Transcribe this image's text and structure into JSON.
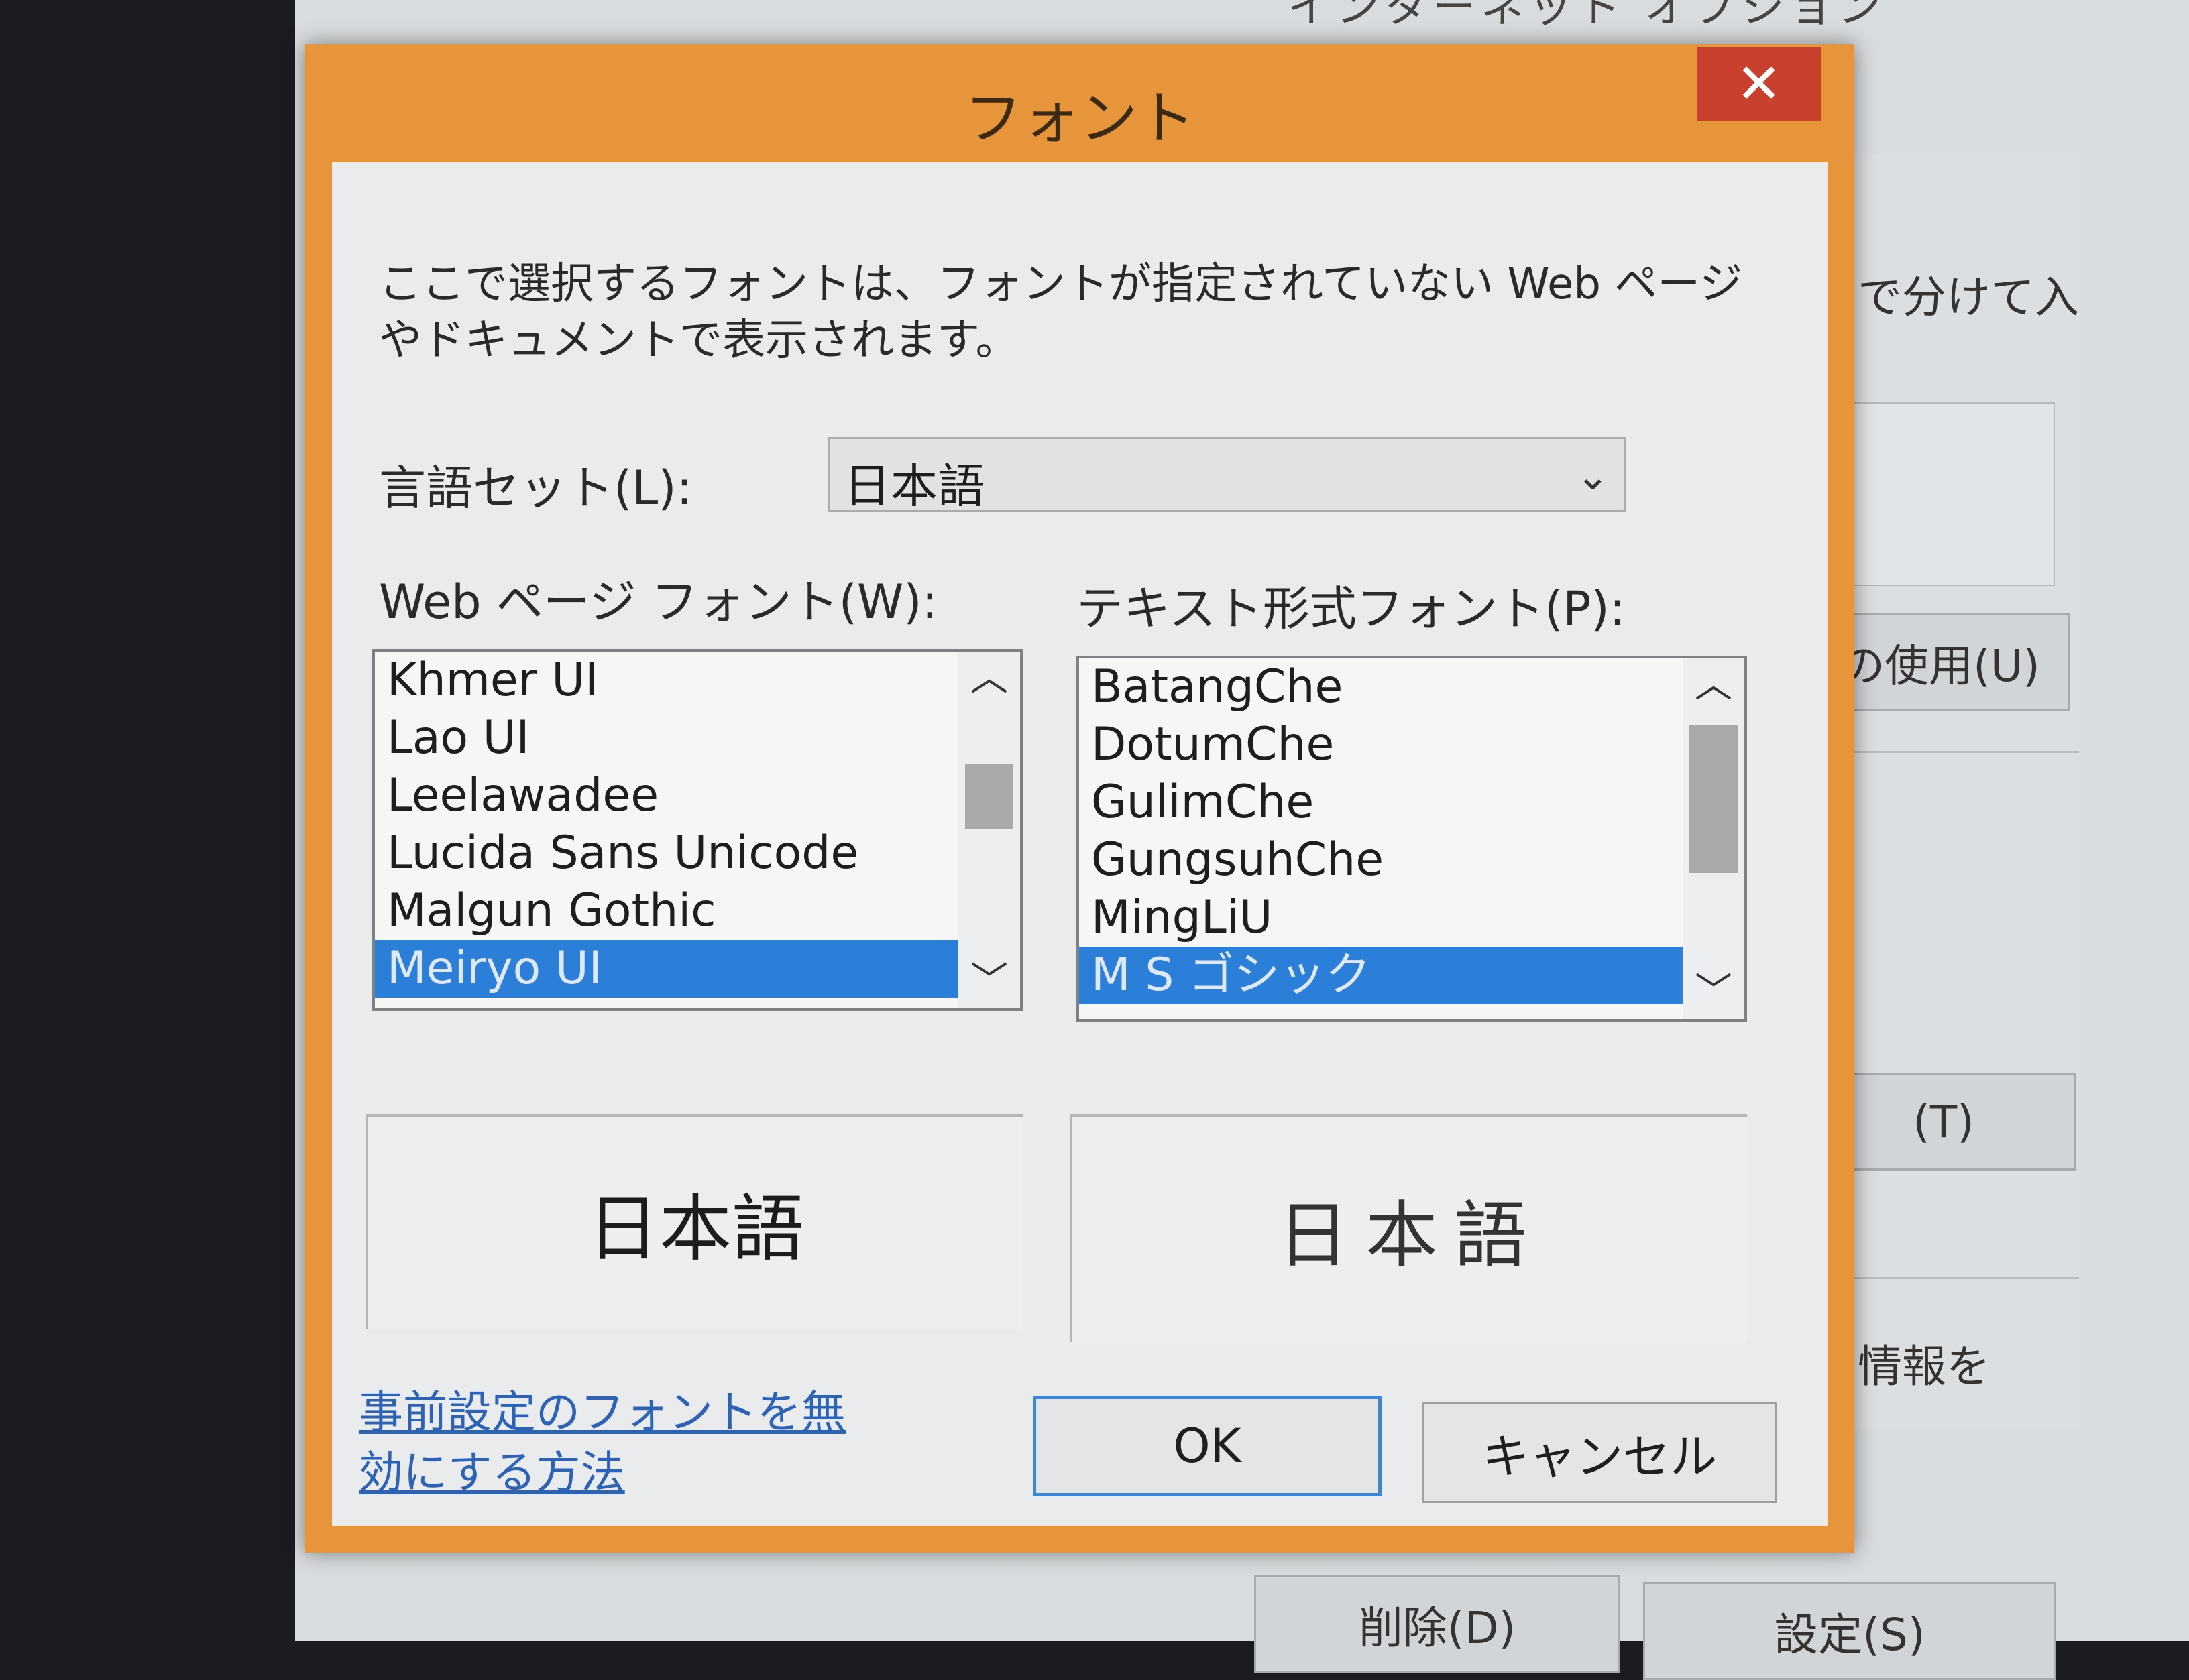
{
  "background": {
    "partial_label_1": "で分けて入",
    "partial_label_2": "の使用(U)",
    "partial_label_3": "(T)",
    "partial_label_4": "情報を",
    "delete_button": "削除(D)",
    "settings_button": "設定(S)"
  },
  "dialog": {
    "title": "フォント",
    "close_glyph": "✕",
    "description": "ここで選択するフォントは、フォントが指定されていない Web ページやドキュメントで表示されます。",
    "language_label": "言語セット(L):",
    "language_value": "日本語",
    "web_font_label": "Web ページ フォント(W):",
    "text_font_label": "テキスト形式フォント(P):",
    "web_fonts": [
      "Khmer UI",
      "Lao UI",
      "Leelawadee",
      "Lucida Sans Unicode",
      "Malgun Gothic",
      "Meiryo UI"
    ],
    "text_fonts": [
      "BatangChe",
      "DotumChe",
      "GulimChe",
      "GungsuhChe",
      "MingLiU",
      "M S ゴシック"
    ],
    "web_preview": "日本語",
    "text_preview": "日本語",
    "link_text": "事前設定のフォントを無効にする方法",
    "ok_label": "OK",
    "cancel_label": "キャンセル"
  },
  "colors": {
    "title_bar": "#e6953a",
    "close_button": "#c9402f",
    "selection": "#2b7fd8",
    "link": "#2d63b6"
  }
}
